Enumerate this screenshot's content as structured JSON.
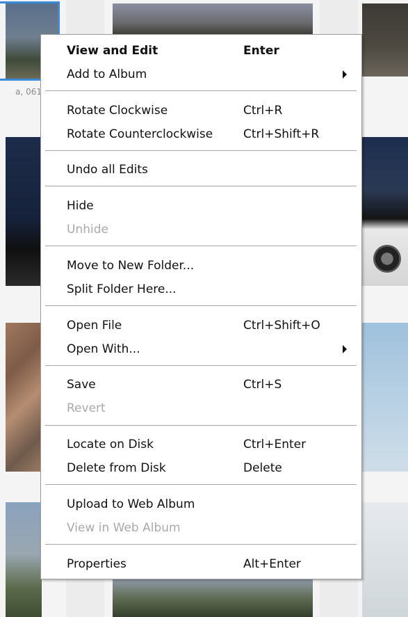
{
  "background": {
    "photo_caption": "a, 061"
  },
  "menu": {
    "items": [
      {
        "label": "View and Edit",
        "shortcut": "Enter"
      },
      {
        "label": "Add to Album",
        "shortcut": ""
      },
      {
        "label": "Rotate Clockwise",
        "shortcut": "Ctrl+R"
      },
      {
        "label": "Rotate Counterclockwise",
        "shortcut": "Ctrl+Shift+R"
      },
      {
        "label": "Undo all Edits",
        "shortcut": ""
      },
      {
        "label": "Hide",
        "shortcut": ""
      },
      {
        "label": "Unhide",
        "shortcut": ""
      },
      {
        "label": "Move to New Folder...",
        "shortcut": ""
      },
      {
        "label": "Split Folder Here...",
        "shortcut": ""
      },
      {
        "label": "Open File",
        "shortcut": "Ctrl+Shift+O"
      },
      {
        "label": "Open With...",
        "shortcut": ""
      },
      {
        "label": "Save",
        "shortcut": "Ctrl+S"
      },
      {
        "label": "Revert",
        "shortcut": ""
      },
      {
        "label": "Locate on Disk",
        "shortcut": "Ctrl+Enter"
      },
      {
        "label": "Delete from Disk",
        "shortcut": "Delete"
      },
      {
        "label": "Upload to Web Album",
        "shortcut": ""
      },
      {
        "label": "View in Web Album",
        "shortcut": ""
      },
      {
        "label": "Properties",
        "shortcut": "Alt+Enter"
      }
    ],
    "disabled": [
      "Unhide",
      "Revert",
      "View in Web Album"
    ],
    "submenu_icon": "submenu-arrow-icon"
  },
  "colors": {
    "selection_border": "#3a8bd9",
    "menu_background": "#ffffff",
    "disabled_text": "#a9a9a9"
  }
}
